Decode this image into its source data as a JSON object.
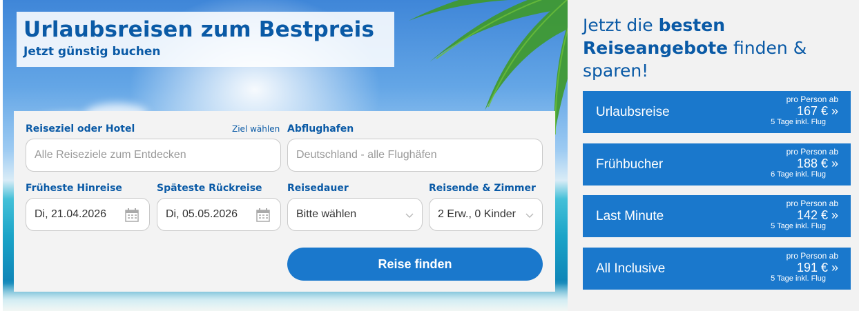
{
  "hero": {
    "title": "Urlaubsreisen zum Bestpreis",
    "subtitle": "Jetzt günstig buchen"
  },
  "form": {
    "destination_label": "Reiseziel oder Hotel",
    "destination_link": "Ziel wählen",
    "destination_placeholder": "Alle Reiseziele zum Entdecken",
    "airport_label": "Abflughafen",
    "airport_placeholder": "Deutschland - alle Flughäfen",
    "depart_label": "Früheste Hinreise",
    "depart_value": "Di, 21.04.2026",
    "return_label": "Späteste Rückreise",
    "return_value": "Di, 05.05.2026",
    "duration_label": "Reisedauer",
    "duration_value": "Bitte wählen",
    "travelers_label": "Reisende & Zimmer",
    "travelers_value": "2 Erw., 0 Kinder",
    "submit_label": "Reise finden"
  },
  "sidebar": {
    "headline_pre": "Jetzt die ",
    "headline_bold": "besten Reiseangebote",
    "headline_post": " finden & sparen!",
    "offers": [
      {
        "name": "Urlaubsreise",
        "pp": "pro Person ab",
        "price": "167 € »",
        "days": "5 Tage inkl. Flug"
      },
      {
        "name": "Frühbucher",
        "pp": "pro Person ab",
        "price": "188 € »",
        "days": "6 Tage inkl. Flug"
      },
      {
        "name": "Last Minute",
        "pp": "pro Person ab",
        "price": "142 € »",
        "days": "5 Tage inkl. Flug"
      },
      {
        "name": "All Inclusive",
        "pp": "pro Person ab",
        "price": "191 € »",
        "days": "5 Tage inkl. Flug"
      }
    ]
  },
  "colors": {
    "brand_blue": "#1a78cc",
    "heading_blue": "#0a5aa6"
  }
}
